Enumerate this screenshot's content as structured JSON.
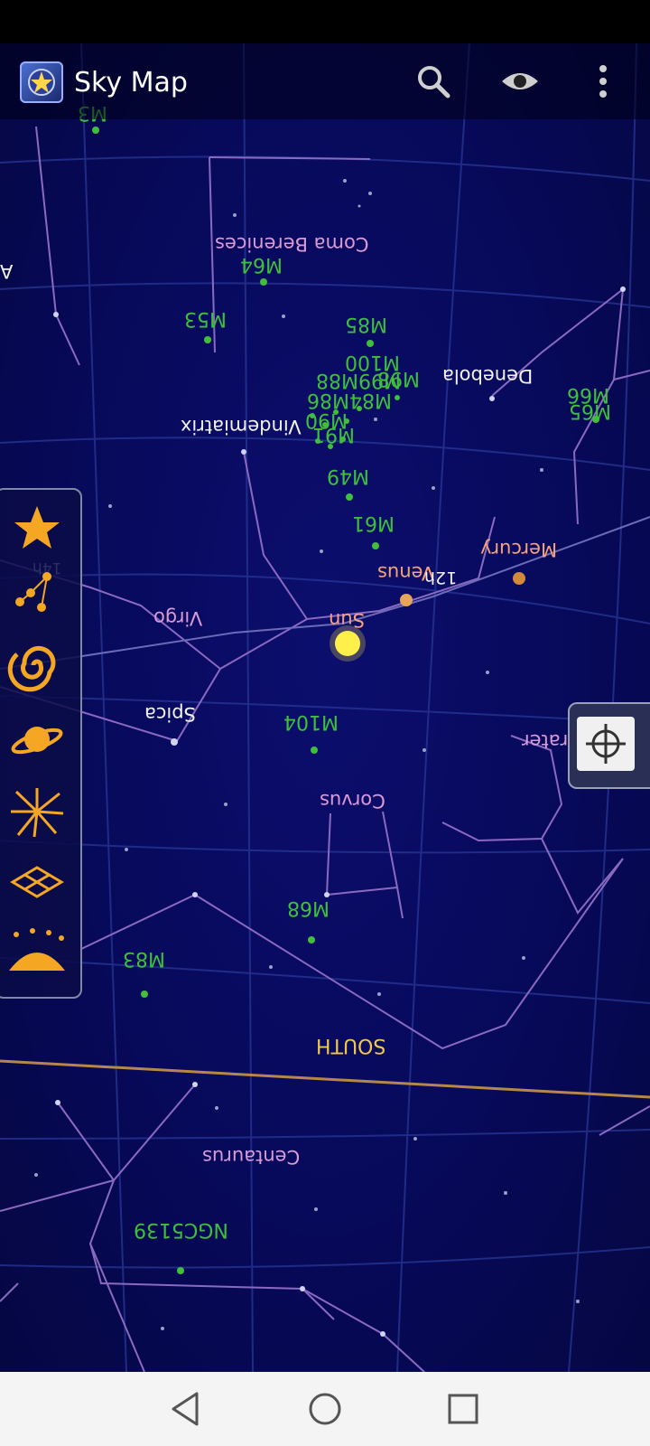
{
  "app": {
    "title": "Sky Map"
  },
  "toolbar": {
    "search_icon": "search-icon",
    "eye_icon": "eye-icon",
    "menu_icon": "more-vert-icon"
  },
  "labels": {
    "m3": "M3",
    "a_edge": "A",
    "coma_berenices": "Coma Berenices",
    "m64": "M64",
    "m53": "M53",
    "m85": "M85",
    "m100": "M100",
    "m98": "M98",
    "m99m88": "M99M88",
    "m91": "M91",
    "m84m86": "M84M86",
    "m90": "M90",
    "denebola": "Denebola",
    "m66": "M66",
    "m65": "M65",
    "vindemiatrix": "Vindemiatrix",
    "m49": "M49",
    "m61": "M61",
    "mercury": "Mercury",
    "venus": "Venus",
    "twelve_h": "12h",
    "fourteen_h": "14h",
    "sun": "Sun",
    "virgo": "Virgo",
    "spica": "Spica",
    "m104": "M104",
    "crater": "Crater",
    "corvus": "Corvus",
    "m68": "M68",
    "m83": "M83",
    "south": "SOUTH",
    "centaurus": "Centaurus",
    "ngc5139": "NGC5139"
  },
  "layers": [
    "stars",
    "constellations",
    "messier-objects",
    "planets",
    "meteor-showers",
    "grid",
    "horizon"
  ],
  "colors": {
    "sky": "#07095a",
    "green_label": "#3fbf3a",
    "pink_label": "#d99ad6",
    "horizon": "#b8864a",
    "sun": "#ffef4a"
  },
  "nav": {
    "back": "back-icon",
    "home": "home-icon",
    "recents": "recents-icon"
  }
}
